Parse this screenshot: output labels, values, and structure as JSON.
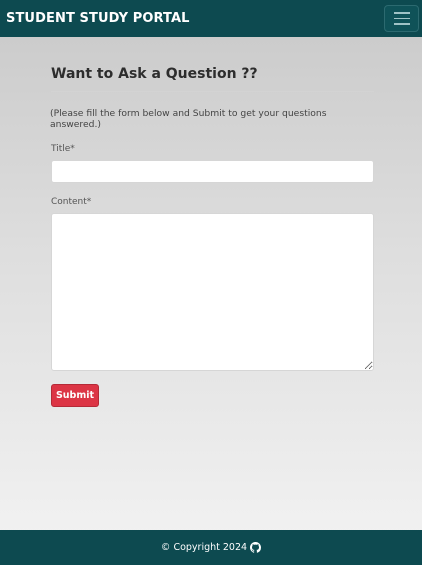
{
  "navbar": {
    "brand": "STUDENT STUDY PORTAL",
    "toggle_icon": "hamburger-menu-icon",
    "background": "#0d4a50"
  },
  "form": {
    "heading": "Want to Ask a Question ??",
    "instructions": "(Please fill the form below and Submit to get your questions answered.)",
    "title_label": "Title*",
    "title_value": "",
    "content_label": "Content*",
    "content_value": "",
    "submit_label": "Submit",
    "submit_color": "#dc3545"
  },
  "footer": {
    "copyright": "© Copyright 2024",
    "icon": "github-icon"
  }
}
